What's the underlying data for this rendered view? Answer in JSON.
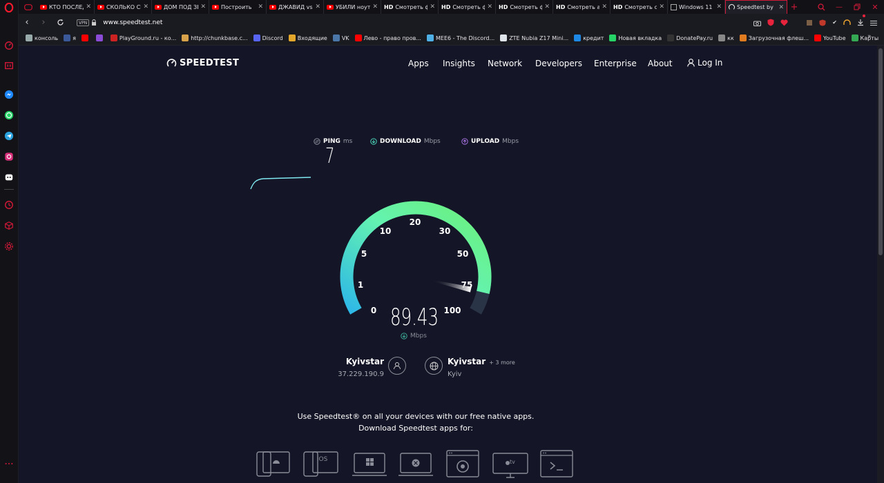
{
  "tabs": [
    {
      "label": "КТО ПОСЛЕДНИЙ",
      "icon": "youtube"
    },
    {
      "label": "СКОЛЬКО СЕКУНД",
      "icon": "youtube"
    },
    {
      "label": "ДОМ ПОД ЗЕМЛЁЙ",
      "icon": "youtube"
    },
    {
      "label": "Построить",
      "icon": "youtube"
    },
    {
      "label": "ДЖАВИД vs",
      "icon": "youtube"
    },
    {
      "label": "УБИЛИ ноут",
      "icon": "youtube"
    },
    {
      "label": "Смотреть фи",
      "icon": "hd"
    },
    {
      "label": "Смотреть фи",
      "icon": "hd"
    },
    {
      "label": "Смотреть фи",
      "icon": "hd"
    },
    {
      "label": "Смотреть ан",
      "icon": "hd"
    },
    {
      "label": "Смотреть се",
      "icon": "hd"
    },
    {
      "label": "Windows 11",
      "icon": "windows"
    },
    {
      "label": "Speedtest by",
      "icon": "speedtest",
      "active": true
    }
  ],
  "address": {
    "url": "www.speedtest.net",
    "vpn": "VPN"
  },
  "bookmarks": [
    {
      "label": "консоль",
      "color": "#9aa"
    },
    {
      "label": "я",
      "color": "#3b5998"
    },
    {
      "label": "",
      "color": "#f00"
    },
    {
      "label": "",
      "color": "#8a4bd6"
    },
    {
      "label": "PlayGround.ru - ко...",
      "color": "#c22"
    },
    {
      "label": "http://chunkbase.c...",
      "color": "#d8a24a"
    },
    {
      "label": "Discord",
      "color": "#5865f2"
    },
    {
      "label": "Входящие",
      "color": "#e3a82b"
    },
    {
      "label": "VK",
      "color": "#4a76a8"
    },
    {
      "label": "Лево - право пров...",
      "color": "#f00"
    },
    {
      "label": "MEE6 - The Discord...",
      "color": "#4fb0e6"
    },
    {
      "label": "ZTE Nubia Z17 Mini...",
      "color": "#dfe3ea"
    },
    {
      "label": "кредит",
      "color": "#1e88e5"
    },
    {
      "label": "Новая вкладка",
      "color": "#25d366"
    },
    {
      "label": "DonatePay.ru",
      "color": "#333"
    },
    {
      "label": "кк",
      "color": "#888"
    },
    {
      "label": "Загрузочная флеш...",
      "color": "#e07b1f"
    },
    {
      "label": "YouTube",
      "color": "#f00"
    },
    {
      "label": "Карты",
      "color": "#34a853"
    }
  ],
  "header": {
    "logo": "SPEEDTEST",
    "nav": [
      "Apps",
      "Insights",
      "Network",
      "Developers",
      "Enterprise",
      "About"
    ],
    "login": "Log In"
  },
  "results": {
    "ping_label": "PING",
    "ping_unit": "ms",
    "ping_value": "7",
    "download_label": "DOWNLOAD",
    "download_unit": "Mbps",
    "upload_label": "UPLOAD",
    "upload_unit": "Mbps"
  },
  "gauge": {
    "ticks": [
      "0",
      "1",
      "5",
      "10",
      "20",
      "30",
      "50",
      "75",
      "100"
    ],
    "value": "89.43",
    "unit": "Mbps",
    "value_fraction": 0.93,
    "gradient": [
      "#2db7e8",
      "#64f3b0",
      "#6cf07a"
    ]
  },
  "connection": {
    "isp": "Kyivstar",
    "ip": "37.229.190.9",
    "server": "Kyivstar",
    "server_more": "+ 3 more",
    "server_city": "Kyiv"
  },
  "promo": {
    "line1": "Use Speedtest® on all your devices with our free native apps.",
    "line2": "Download Speedtest apps for:"
  },
  "devices": [
    "android",
    "iOS",
    "windows",
    "mac",
    "chrome",
    "apple-tv",
    "cli"
  ]
}
